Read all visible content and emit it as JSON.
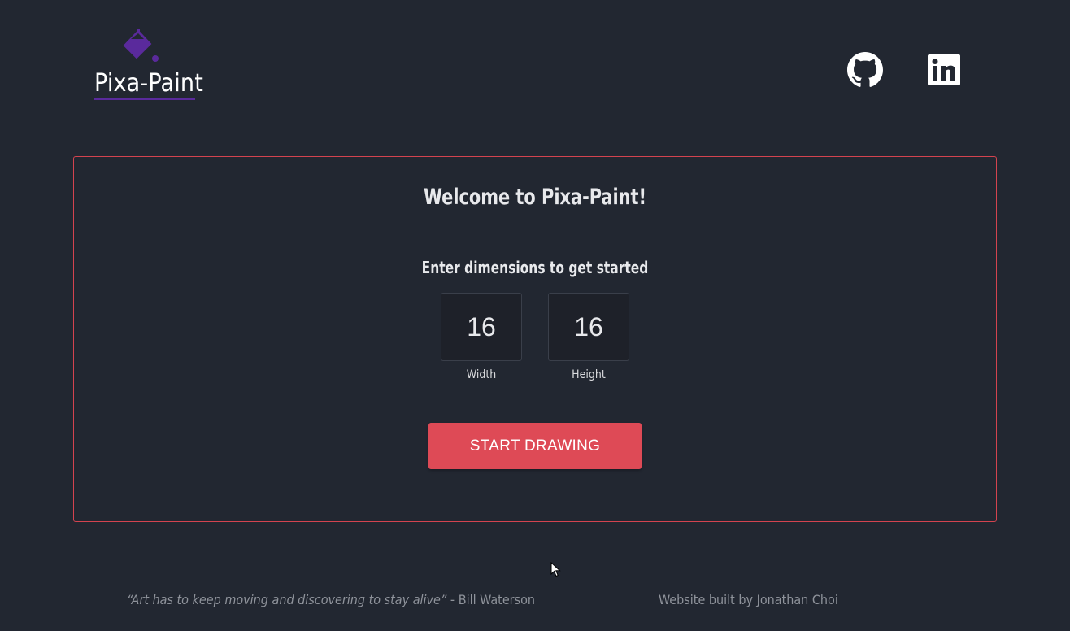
{
  "header": {
    "logo_text": "Pixa-Paint",
    "logo_icon": "paint-bucket-icon",
    "social": [
      {
        "name": "GitHub",
        "icon": "github-icon"
      },
      {
        "name": "LinkedIn",
        "icon": "linkedin-icon"
      }
    ]
  },
  "main": {
    "title": "Welcome to Pixa-Paint!",
    "subtitle": "Enter dimensions to get started",
    "width": {
      "value": "16",
      "label": "Width"
    },
    "height": {
      "value": "16",
      "label": "Height"
    },
    "start_button_label": "START DRAWING"
  },
  "footer": {
    "quote_text": "“Art has to keep moving and discovering to stay alive”",
    "quote_author": " - Bill Waterson",
    "credit": "Website built by Jonathan Choi"
  },
  "colors": {
    "background": "#222731",
    "accent": "#de4a56",
    "panel_border": "#d4434f",
    "logo_purple": "#5a2a9c"
  }
}
